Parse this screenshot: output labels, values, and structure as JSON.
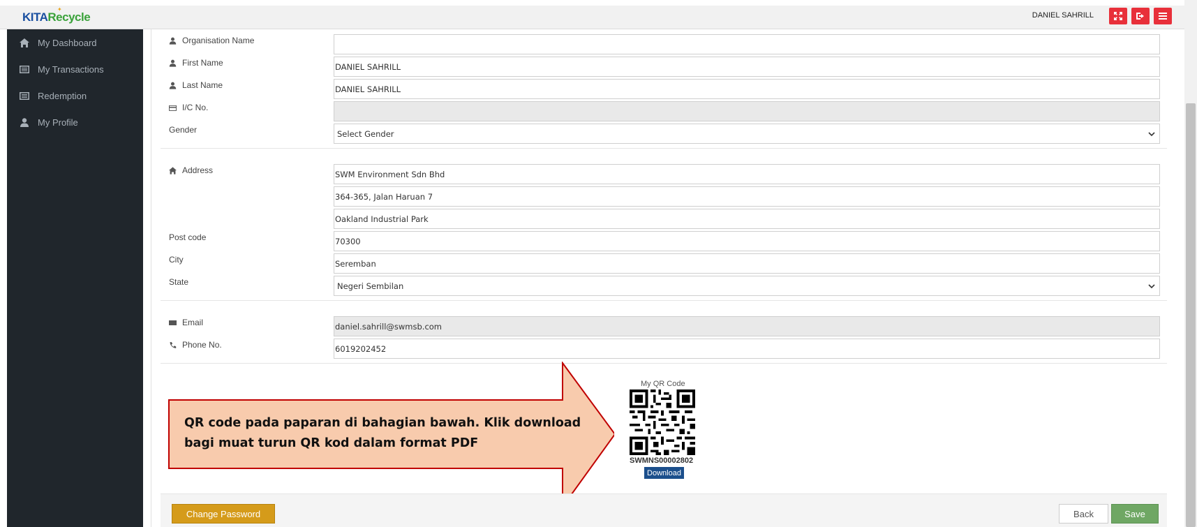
{
  "header": {
    "logo_kita": "KITA",
    "logo_recycle": "Recycle",
    "user_name": "DANIEL SAHRILL",
    "accent_color": "#e8303a"
  },
  "sidebar": {
    "items": [
      {
        "label": "My Dashboard",
        "icon": "home-icon"
      },
      {
        "label": "My Transactions",
        "icon": "list-icon"
      },
      {
        "label": "Redemption",
        "icon": "list-icon"
      },
      {
        "label": "My Profile",
        "icon": "user-icon"
      }
    ]
  },
  "form": {
    "organisation_label": "Organisation Name",
    "organisation_value": "",
    "first_name_label": "First Name",
    "first_name_value": "DANIEL SAHRILL",
    "last_name_label": "Last Name",
    "last_name_value": "DANIEL SAHRILL",
    "ic_label": "I/C No.",
    "ic_value": "",
    "gender_label": "Gender",
    "gender_value": "Select Gender",
    "address_label": "Address",
    "address_line1": "SWM Environment Sdn Bhd",
    "address_line2": "364-365, Jalan Haruan 7",
    "address_line3": "Oakland Industrial Park",
    "postcode_label": "Post code",
    "postcode_value": "70300",
    "city_label": "City",
    "city_value": "Seremban",
    "state_label": "State",
    "state_value": "Negeri Sembilan",
    "email_label": "Email",
    "email_value": "daniel.sahrill@swmsb.com",
    "phone_label": "Phone No.",
    "phone_value": "6019202452"
  },
  "qr": {
    "title": "My QR Code",
    "code": "SWMNS00002802",
    "download_label": "Download"
  },
  "callout": {
    "text": "QR code pada paparan di bahagian bawah. Klik download bagi muat turun QR kod dalam format PDF"
  },
  "footer": {
    "change_password_label": "Change Password",
    "back_label": "Back",
    "save_label": "Save"
  }
}
